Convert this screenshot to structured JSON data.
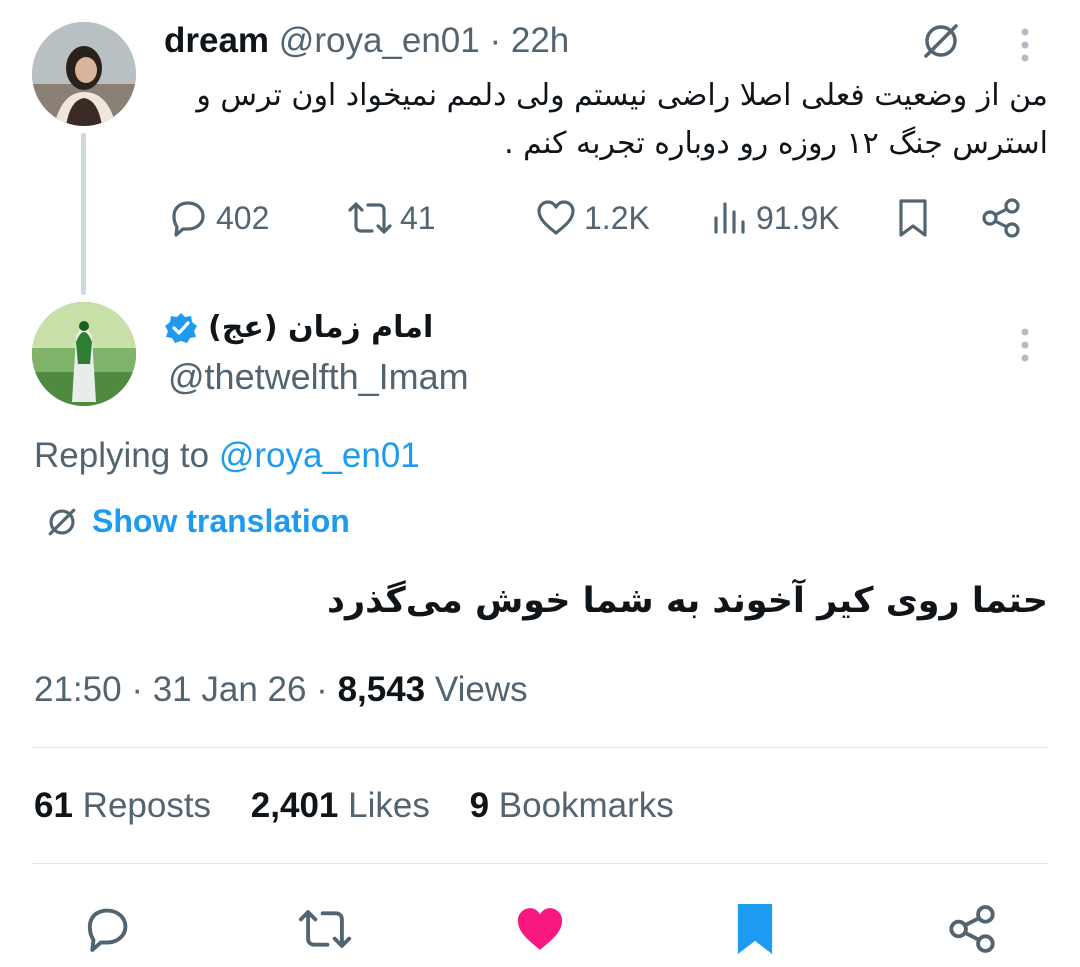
{
  "parent": {
    "name": "dream",
    "handle": "@roya_en01",
    "time_sep": " · ",
    "time": "22h",
    "text": "من از وضعیت فعلی اصلا راضی نیستم ولی دلمم نمیخواد اون ترس و استرس جنگ ۱۲ روزه رو دوباره تجربه کنم .",
    "replies": "402",
    "reposts": "41",
    "likes": "1.2K",
    "views": "91.9K",
    "icons": [
      "translate-icon",
      "more-icon",
      "reply-icon",
      "repost-icon",
      "like-icon",
      "views-icon",
      "bookmark-icon",
      "share-icon"
    ]
  },
  "reply": {
    "name": "امام زمان (عج)",
    "handle": "@thetwelfth_Imam",
    "replying_label": "Replying to ",
    "replying_handle": "@roya_en01",
    "show_translation": "Show translation",
    "text": "حتما روی کیر آخوند به شما خوش می‌گذرد",
    "time": "21:50",
    "dot1": " · ",
    "date": "31 Jan 26",
    "dot2": " · ",
    "views_count": "8,543",
    "views_label": " Views",
    "reposts_count": "61",
    "reposts_label": " Reposts",
    "likes_count": "2,401",
    "likes_label": " Likes",
    "bookmarks_count": "9",
    "bookmarks_label": " Bookmarks",
    "verified": true
  },
  "colors": {
    "accent": "#1d9bf0",
    "like": "#f91880",
    "text": "#0f1419",
    "muted": "#536471",
    "divider": "#e1e8ed"
  }
}
